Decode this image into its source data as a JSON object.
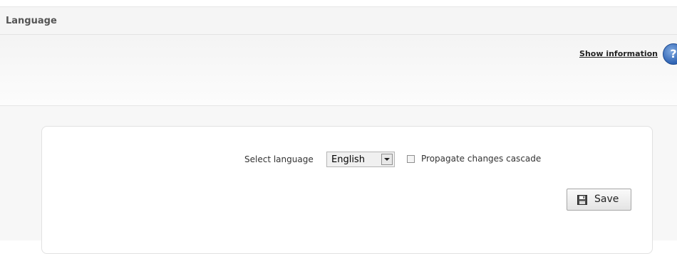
{
  "header": {
    "title": "Language"
  },
  "info": {
    "show_information": "Show information",
    "help_icon": "help-question-icon",
    "help_symbol": "?"
  },
  "form": {
    "select_label": "Select language",
    "language": {
      "selected": "English"
    },
    "cascade": {
      "label": "Propagate changes cascade",
      "checked": false
    },
    "save_label": "Save",
    "save_icon": "floppy-disk-icon"
  },
  "colors": {
    "help_icon_blue": "#2f63b3",
    "page_background": "#f7f7f7",
    "panel_background": "#ffffff"
  }
}
